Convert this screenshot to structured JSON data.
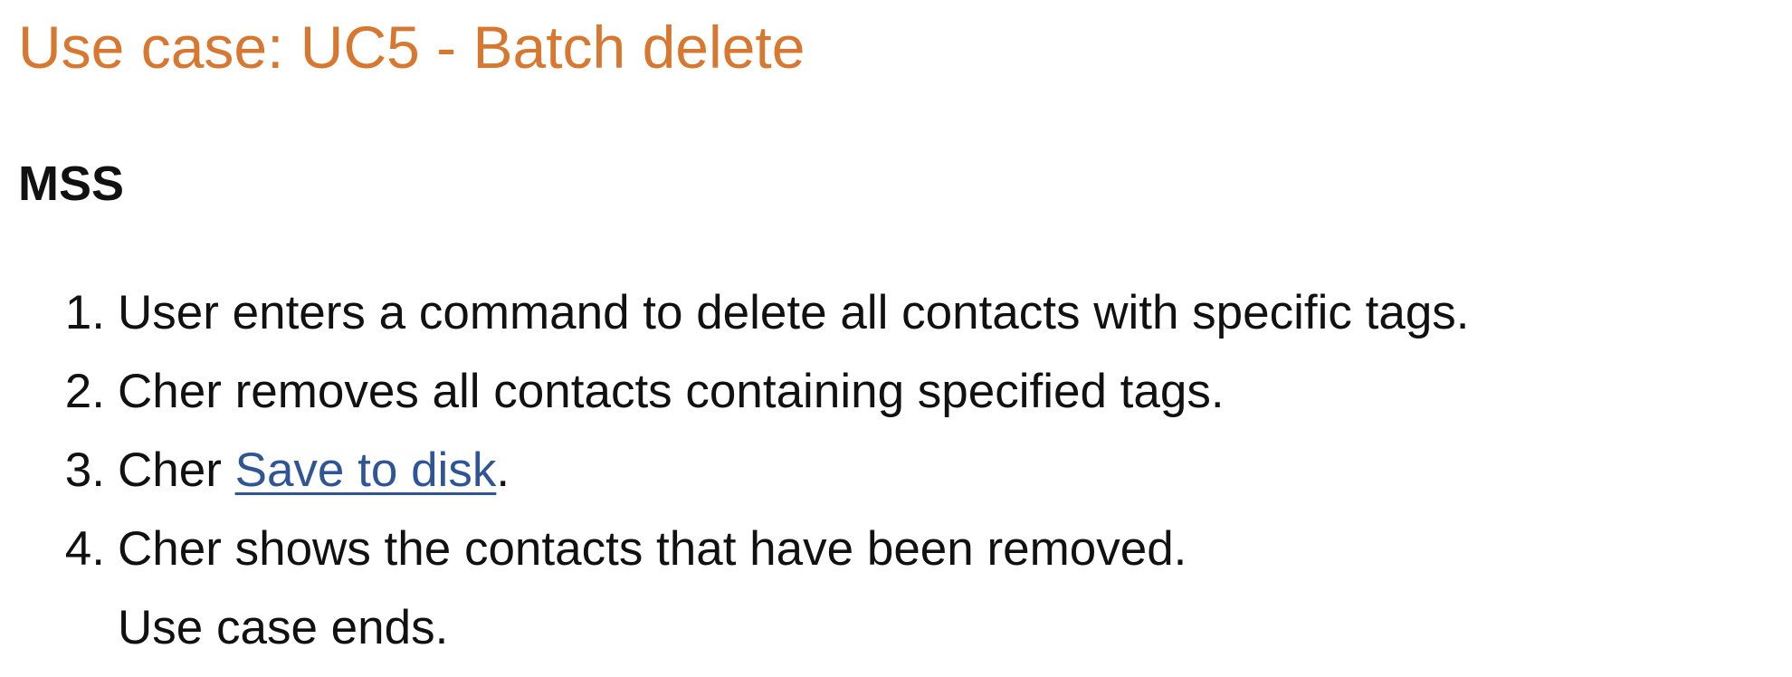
{
  "title": "Use case: UC5 - Batch delete",
  "section_heading": "MSS",
  "steps": [
    {
      "number": "1.",
      "text": "User enters a command to delete all contacts with specific tags."
    },
    {
      "number": "2.",
      "text": "Cher removes all contacts containing specified tags."
    },
    {
      "number": "3.",
      "prefix": "Cher ",
      "link": "Save to disk",
      "suffix": "."
    },
    {
      "number": "4.",
      "text": "Cher shows the contacts that have been removed."
    }
  ],
  "ending": "Use case ends.",
  "colors": {
    "title": "#d8772f",
    "link": "#2f5597",
    "text": "#111111"
  }
}
